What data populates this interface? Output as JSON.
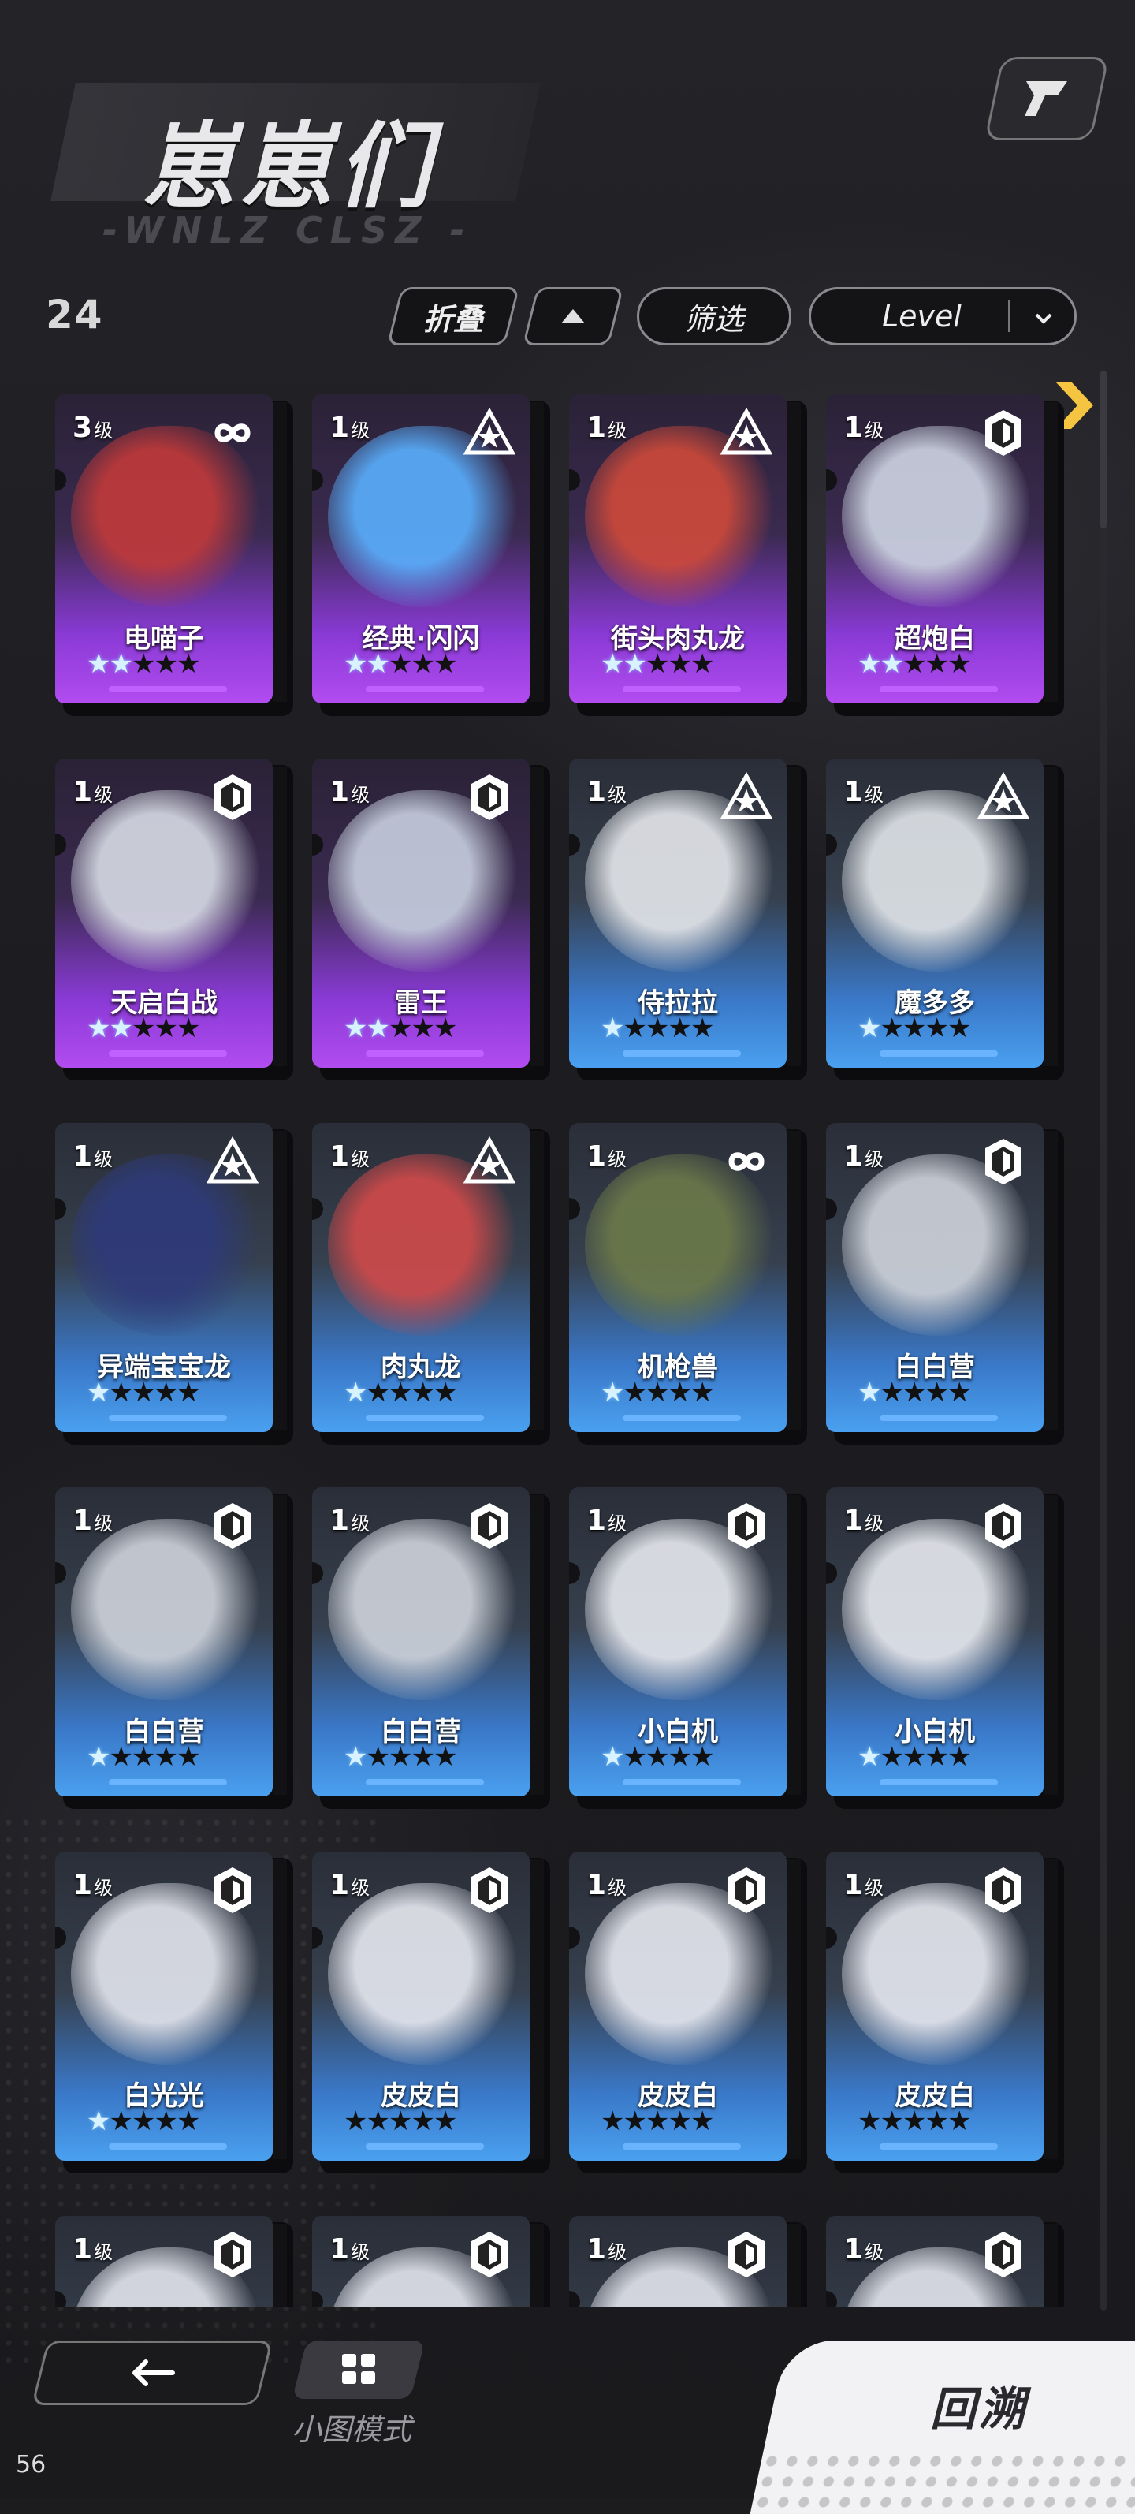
{
  "header": {
    "title": "崽崽们",
    "subtitle": "-WNLZ CLSZ -",
    "count": "24"
  },
  "toolbar": {
    "fold_label": "折叠",
    "filter_label": "筛选",
    "sort_label": "Level"
  },
  "icons": {
    "corner": "share-icon",
    "sort_direction": "triangle-up-icon",
    "sort_dropdown": "chevron-down-icon",
    "scroll_next": "chevron-right-icon",
    "back": "arrow-left-icon",
    "mode": "grid-icon"
  },
  "cards": [
    {
      "level": "3",
      "unit": "级",
      "name": "电喵子",
      "rarity": "purple",
      "stars_on": 2,
      "rank_icon": "infinity-icon",
      "art": "#c23a3a"
    },
    {
      "level": "1",
      "unit": "级",
      "name": "经典·闪闪",
      "rarity": "purple",
      "stars_on": 2,
      "rank_icon": "triangle-star-icon",
      "art": "#5ab0ff"
    },
    {
      "level": "1",
      "unit": "级",
      "name": "街头肉丸龙",
      "rarity": "purple",
      "stars_on": 2,
      "rank_icon": "triangle-star-icon",
      "art": "#d04a3a"
    },
    {
      "level": "1",
      "unit": "级",
      "name": "超炮白",
      "rarity": "purple",
      "stars_on": 2,
      "rank_icon": "hexagon-icon",
      "art": "#cfd6e4"
    },
    {
      "level": "1",
      "unit": "级",
      "name": "天启白战",
      "rarity": "purple",
      "stars_on": 2,
      "rank_icon": "hexagon-icon",
      "art": "#d8dce6"
    },
    {
      "level": "1",
      "unit": "级",
      "name": "雷王",
      "rarity": "purple",
      "stars_on": 2,
      "rank_icon": "hexagon-icon",
      "art": "#c8d0e0"
    },
    {
      "level": "1",
      "unit": "级",
      "name": "侍拉拉",
      "rarity": "blue",
      "stars_on": 1,
      "rank_icon": "triangle-star-icon",
      "art": "#e6e8ec"
    },
    {
      "level": "1",
      "unit": "级",
      "name": "魔多多",
      "rarity": "blue",
      "stars_on": 1,
      "rank_icon": "triangle-star-icon",
      "art": "#e2e6ea"
    },
    {
      "level": "1",
      "unit": "级",
      "name": "异端宝宝龙",
      "rarity": "blue",
      "stars_on": 1,
      "rank_icon": "triangle-star-icon",
      "art": "#2e3a7a"
    },
    {
      "level": "1",
      "unit": "级",
      "name": "肉丸龙",
      "rarity": "blue",
      "stars_on": 1,
      "rank_icon": "triangle-star-icon",
      "art": "#d24a4a"
    },
    {
      "level": "1",
      "unit": "级",
      "name": "机枪兽",
      "rarity": "blue",
      "stars_on": 1,
      "rank_icon": "infinity-icon",
      "art": "#6c7a4a"
    },
    {
      "level": "1",
      "unit": "级",
      "name": "白白营",
      "rarity": "blue",
      "stars_on": 1,
      "rank_icon": "hexagon-icon",
      "art": "#cfd4dc"
    },
    {
      "level": "1",
      "unit": "级",
      "name": "白白营",
      "rarity": "blue",
      "stars_on": 1,
      "rank_icon": "hexagon-icon",
      "art": "#cfd4dc"
    },
    {
      "level": "1",
      "unit": "级",
      "name": "白白营",
      "rarity": "blue",
      "stars_on": 1,
      "rank_icon": "hexagon-icon",
      "art": "#cfd4dc"
    },
    {
      "level": "1",
      "unit": "级",
      "name": "小白机",
      "rarity": "blue",
      "stars_on": 1,
      "rank_icon": "hexagon-icon",
      "art": "#e8eaf0"
    },
    {
      "level": "1",
      "unit": "级",
      "name": "小白机",
      "rarity": "blue",
      "stars_on": 1,
      "rank_icon": "hexagon-icon",
      "art": "#e8eaf0"
    },
    {
      "level": "1",
      "unit": "级",
      "name": "白光光",
      "rarity": "blue",
      "stars_on": 1,
      "rank_icon": "hexagon-icon",
      "art": "#e4e6ee"
    },
    {
      "level": "1",
      "unit": "级",
      "name": "皮皮白",
      "rarity": "blue",
      "stars_on": 0,
      "rank_icon": "hexagon-icon",
      "art": "#e8eaf2"
    },
    {
      "level": "1",
      "unit": "级",
      "name": "皮皮白",
      "rarity": "blue",
      "stars_on": 0,
      "rank_icon": "hexagon-icon",
      "art": "#e8eaf2"
    },
    {
      "level": "1",
      "unit": "级",
      "name": "皮皮白",
      "rarity": "blue",
      "stars_on": 0,
      "rank_icon": "hexagon-icon",
      "art": "#e8eaf2"
    },
    {
      "level": "1",
      "unit": "级",
      "name": "",
      "rarity": "blue",
      "stars_on": 0,
      "rank_icon": "hexagon-icon",
      "art": "#e4e6ee"
    },
    {
      "level": "1",
      "unit": "级",
      "name": "",
      "rarity": "blue",
      "stars_on": 0,
      "rank_icon": "hexagon-icon",
      "art": "#e4e6ee"
    },
    {
      "level": "1",
      "unit": "级",
      "name": "",
      "rarity": "blue",
      "stars_on": 0,
      "rank_icon": "hexagon-icon",
      "art": "#e4e6ee"
    },
    {
      "level": "1",
      "unit": "级",
      "name": "",
      "rarity": "blue",
      "stars_on": 0,
      "rank_icon": "hexagon-icon",
      "art": "#e4e6ee"
    }
  ],
  "footer": {
    "mode_label": "小图模式",
    "return_label": "回溯",
    "fps": "56"
  },
  "colors": {
    "purple_rarity": "#b24cf0",
    "blue_rarity": "#4aa0f0",
    "accent_arrow": "#f5c542"
  }
}
